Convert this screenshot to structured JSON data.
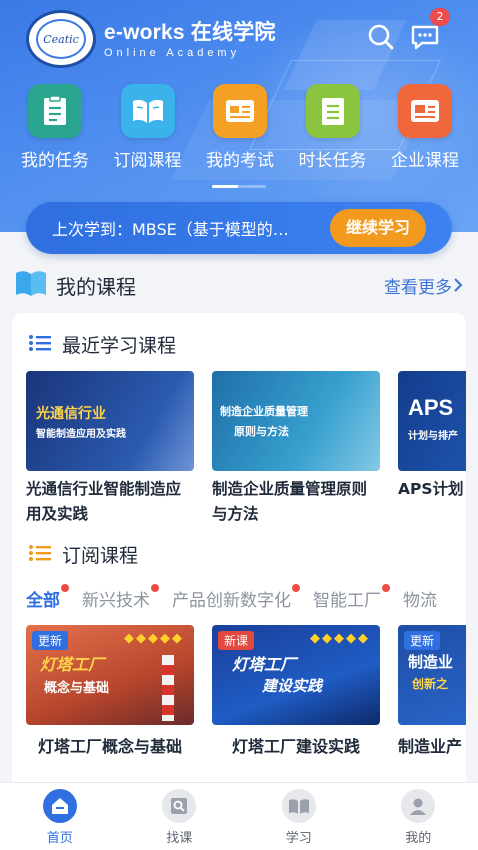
{
  "brand": {
    "logo_text": "Ceatic",
    "title": "e-works 在线学院",
    "subtitle": "Online Academy"
  },
  "header": {
    "message_badge": "2"
  },
  "categories": [
    {
      "label": "我的任务",
      "icon": "clipboard-icon",
      "color": "#2aa58f"
    },
    {
      "label": "订阅课程",
      "icon": "book-open-icon",
      "color": "#39b3ea"
    },
    {
      "label": "我的考试",
      "icon": "exam-card-icon",
      "color": "#f4a024"
    },
    {
      "label": "时长任务",
      "icon": "checklist-icon",
      "color": "#8bc53f"
    },
    {
      "label": "企业课程",
      "icon": "enterprise-card-icon",
      "color": "#f0673c"
    }
  ],
  "resume": {
    "text": "上次学到：MBSE（基于模型的…",
    "button": "继续学习"
  },
  "my_courses": {
    "title": "我的课程",
    "more": "查看更多"
  },
  "recent": {
    "title": "最近学习课程",
    "items": [
      {
        "name": "光通信行业智能制造应用及实践",
        "thumb_title": "光通信行业",
        "thumb_sub": "智能制造应用及实践",
        "color": "#1d3f86"
      },
      {
        "name": "制造企业质量管理原则与方法",
        "thumb_title": "制造企业质量管理",
        "thumb_sub": "原则与方法",
        "color": "#2e86b8"
      },
      {
        "name": "APS计划",
        "thumb_title": "APS",
        "thumb_sub": "计划与排产",
        "color": "#1b4fa3"
      }
    ]
  },
  "subscribed": {
    "title": "订阅课程",
    "tabs": [
      "全部",
      "新兴技术",
      "产品创新数字化",
      "智能工厂",
      "物流"
    ],
    "items": [
      {
        "name": "灯塔工厂概念与基础",
        "tag": "更新",
        "tag_color": "#2f6fe0",
        "thumb_title": "灯塔工厂",
        "thumb_sub": "概念与基础",
        "color": "#c65a3a"
      },
      {
        "name": "灯塔工厂建设实践",
        "tag": "新课",
        "tag_color": "#e2483d",
        "thumb_title": "灯塔工厂",
        "thumb_sub": "建设实践",
        "color": "#1e3f8f"
      },
      {
        "name": "制造业产",
        "tag": "更新",
        "tag_color": "#2f6fe0",
        "thumb_title": "制造业",
        "thumb_sub": "创新之",
        "color": "#2256a8"
      }
    ]
  },
  "tabbar": [
    {
      "label": "首页",
      "icon": "home-icon",
      "active": true
    },
    {
      "label": "找课",
      "icon": "find-course-icon",
      "active": false
    },
    {
      "label": "学习",
      "icon": "study-book-icon",
      "active": false
    },
    {
      "label": "我的",
      "icon": "profile-icon",
      "active": false
    }
  ]
}
